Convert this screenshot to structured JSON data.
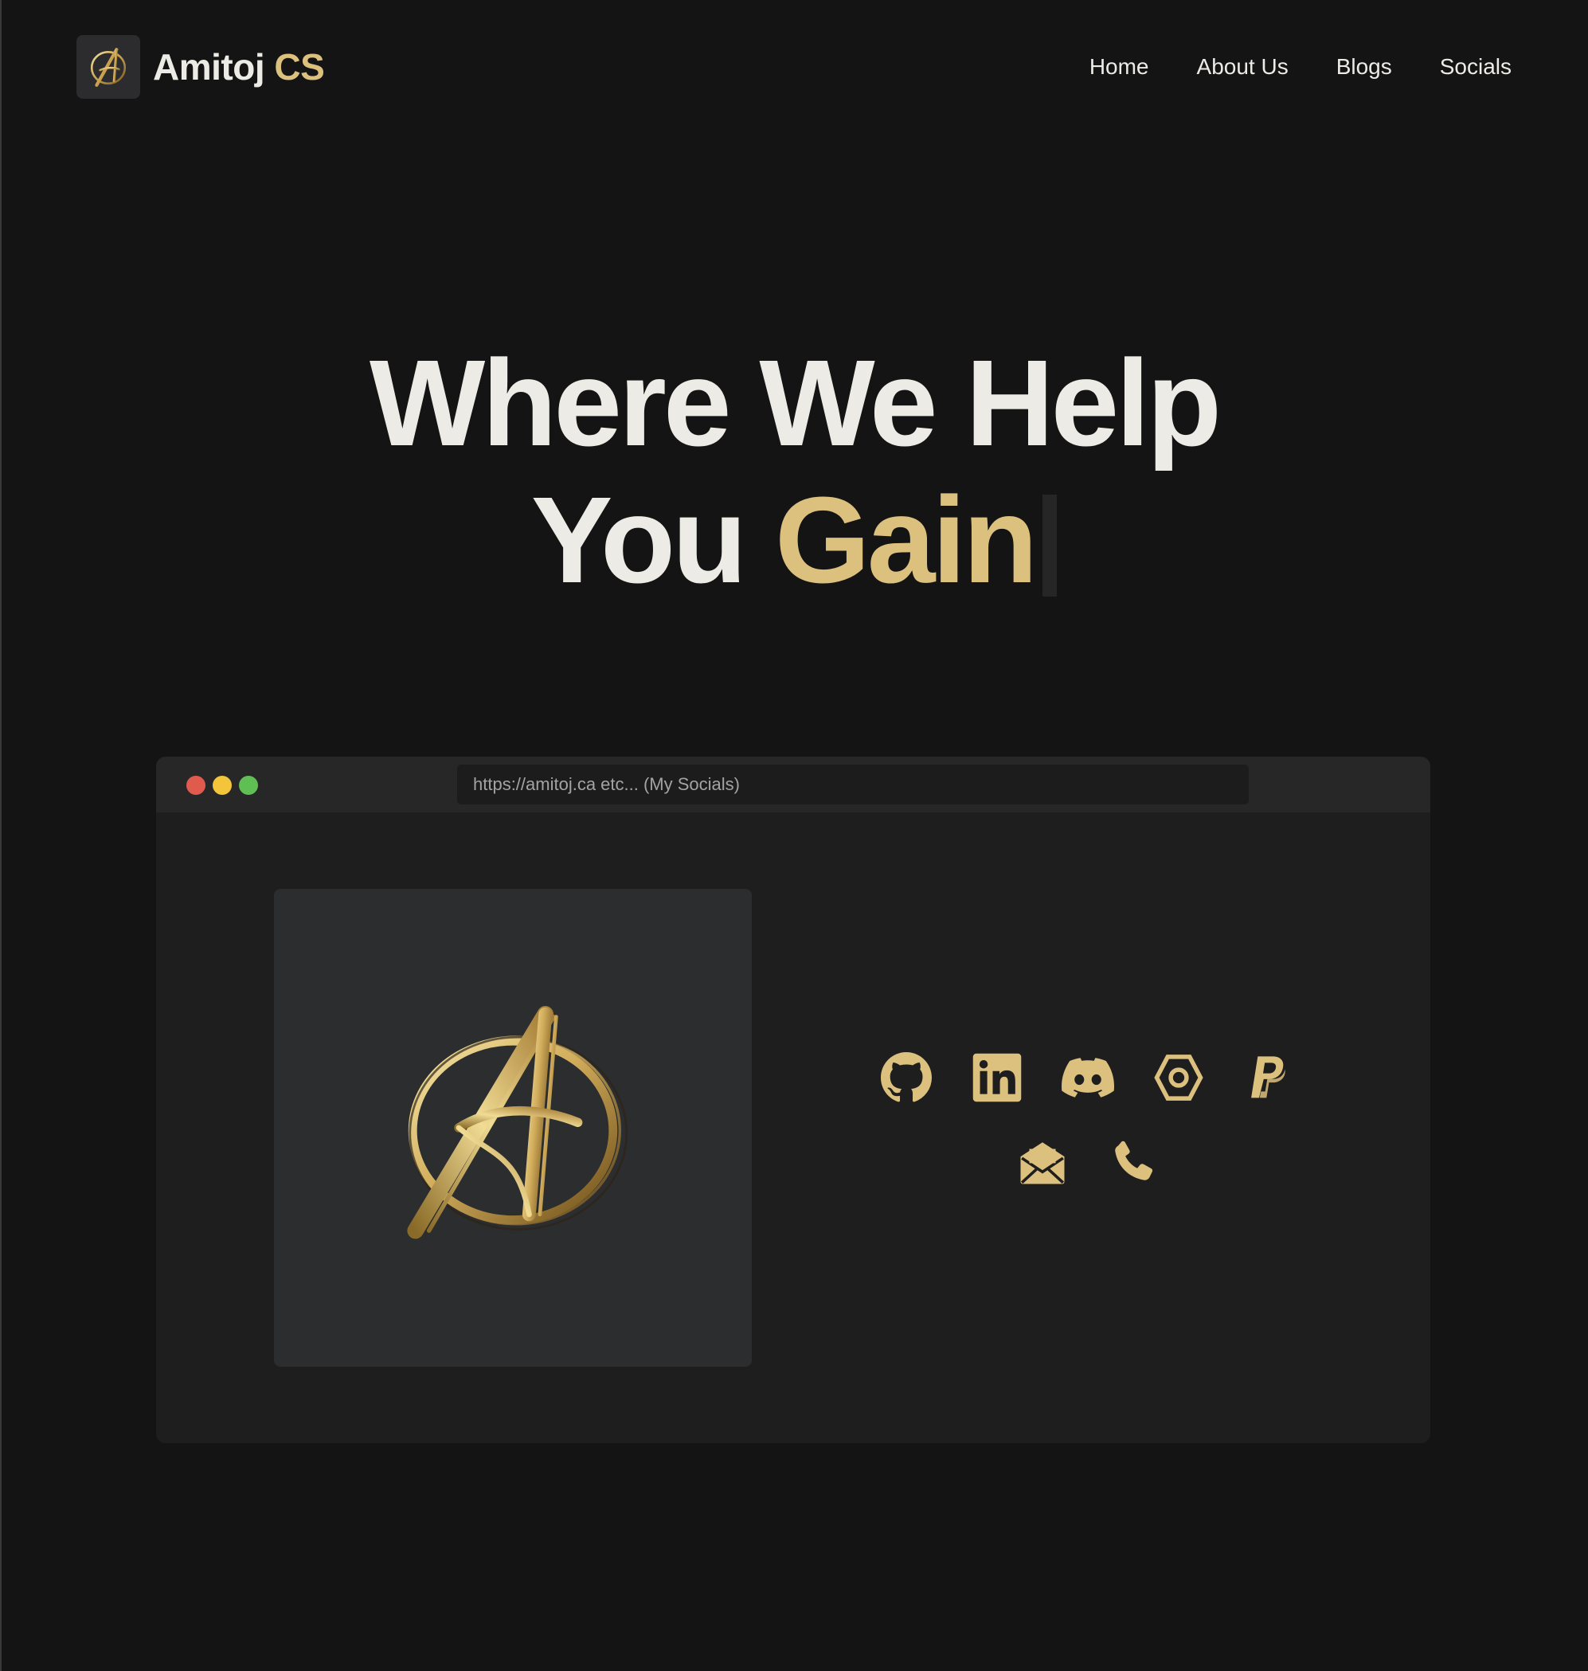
{
  "brand": {
    "name_first": "Amitoj",
    "name_accent": "CS",
    "logo_icon": "amitoj-monogram-a-icon"
  },
  "nav": {
    "items": [
      {
        "label": "Home"
      },
      {
        "label": "About Us"
      },
      {
        "label": "Blogs"
      },
      {
        "label": "Socials"
      }
    ]
  },
  "hero": {
    "line1": "Where We Help",
    "line2_plain": "You",
    "line2_accent": "Gain"
  },
  "browser": {
    "url_text": "https://amitoj.ca etc... (My Socials)",
    "window_controls": [
      "close",
      "minimize",
      "maximize"
    ]
  },
  "socials": {
    "icons": [
      {
        "name": "github-icon"
      },
      {
        "name": "linkedin-icon"
      },
      {
        "name": "discord-icon"
      },
      {
        "name": "hexagon-icon"
      },
      {
        "name": "paypal-icon"
      },
      {
        "name": "mail-icon"
      },
      {
        "name": "phone-icon"
      }
    ]
  },
  "colors": {
    "background": "#141414",
    "accent": "#dcc07e",
    "text": "#ecebe6",
    "card": "#2c2d2f",
    "browser_body": "#1e1e1e",
    "browser_bar": "#272727"
  }
}
